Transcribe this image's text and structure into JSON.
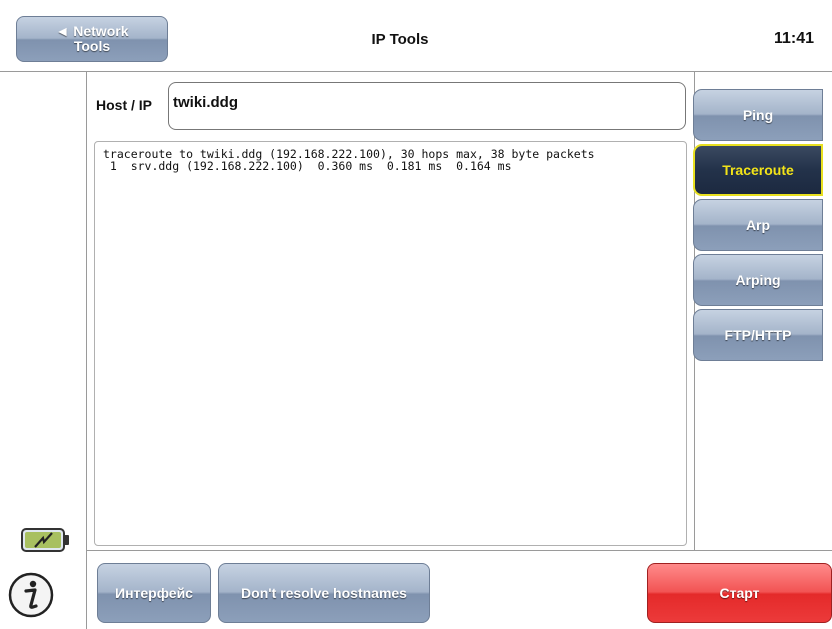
{
  "header": {
    "back_button": {
      "line1": "◄ Network",
      "line2": "Tools"
    },
    "title": "IP Tools",
    "clock": "11:41"
  },
  "host": {
    "label": "Host / IP",
    "value": "twiki.ddg"
  },
  "output": {
    "text": "traceroute to twiki.ddg (192.168.222.100), 30 hops max, 38 byte packets\n 1  srv.ddg (192.168.222.100)  0.360 ms  0.181 ms  0.164 ms"
  },
  "tabs": [
    {
      "label": "Ping",
      "active": false
    },
    {
      "label": "Traceroute",
      "active": true
    },
    {
      "label": "Arp",
      "active": false
    },
    {
      "label": "Arping",
      "active": false
    },
    {
      "label": "FTP/HTTP",
      "active": false
    }
  ],
  "footer": {
    "interface_button": "Интерфейс",
    "resolve_button": "Don't resolve hostnames",
    "start_button": "Старт"
  },
  "colors": {
    "button_blue": "#8c9fba",
    "active_tab": "#23324a",
    "active_tab_text": "#f3e418",
    "start_red": "#ec3a3a"
  },
  "icons": {
    "battery": "battery-charging-icon",
    "info": "info-icon"
  }
}
